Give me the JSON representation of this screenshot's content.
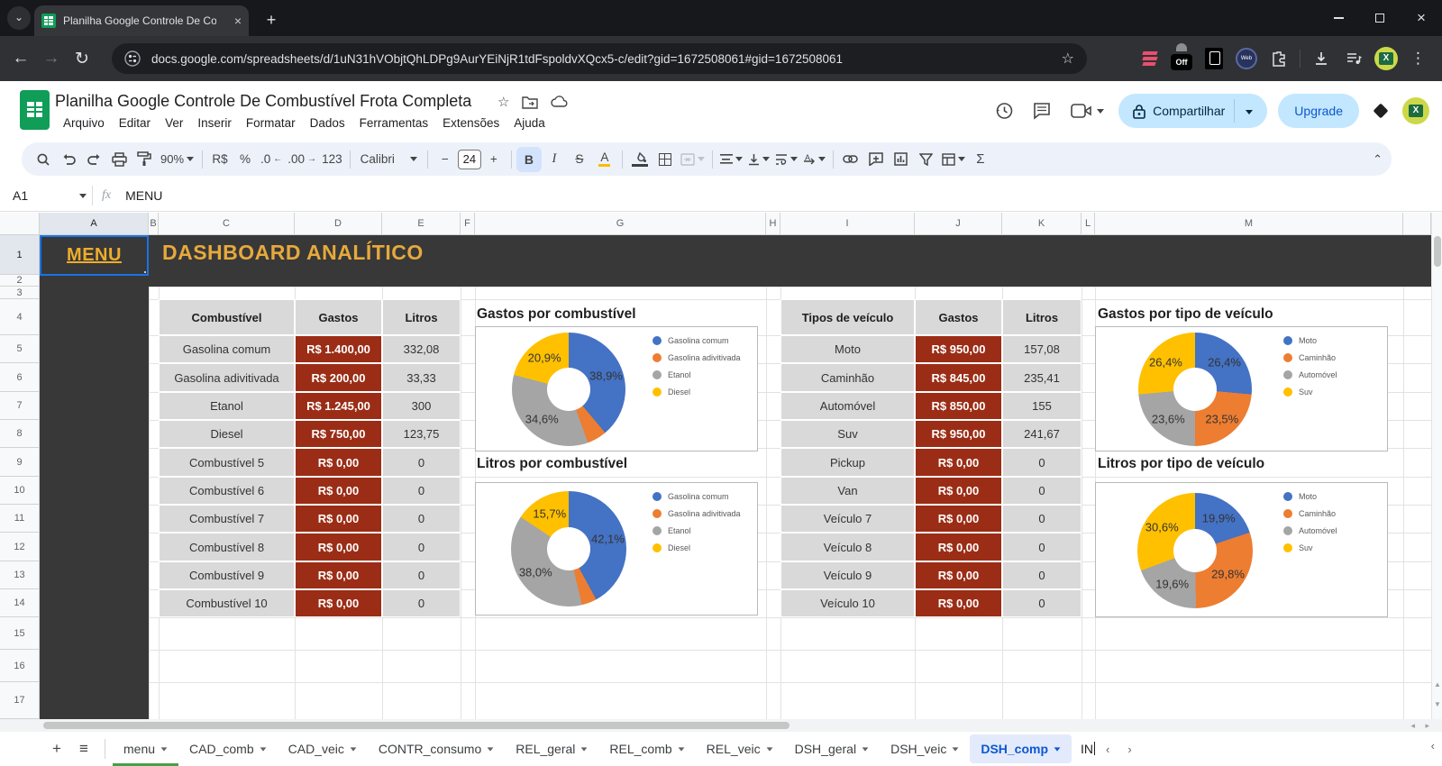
{
  "browser": {
    "tab_title": "Planilha Google Controle De Co",
    "url": "docs.google.com/spreadsheets/d/1uN31hVObjtQhLDPg9AurYEiNjR1tdFspoldvXQcx5-c/edit?gid=1672508061#gid=1672508061",
    "web_badge": "Web",
    "off_badge": "Off"
  },
  "header": {
    "title": "Planilha Google Controle De Combustível Frota Completa",
    "menus": [
      "Arquivo",
      "Editar",
      "Ver",
      "Inserir",
      "Formatar",
      "Dados",
      "Ferramentas",
      "Extensões",
      "Ajuda"
    ],
    "share_label": "Compartilhar",
    "upgrade_label": "Upgrade"
  },
  "toolbar": {
    "zoom": "90%",
    "currency": "R$",
    "percent": "%",
    "dec_decimal": ".0",
    "inc_decimal": ".00",
    "format_123": "123",
    "font": "Calibri",
    "font_size": "24",
    "bold": "B",
    "italic": "I",
    "strike": "S",
    "text_color": "A",
    "fill": "A",
    "sum": "Σ"
  },
  "formula_bar": {
    "cell_ref": "A1",
    "fx": "fx",
    "value": "MENU"
  },
  "grid": {
    "col_letters": [
      "A",
      "B",
      "C",
      "D",
      "E",
      "F",
      "G",
      "H",
      "I",
      "J",
      "K",
      "L",
      "M"
    ],
    "row_numbers": [
      "1",
      "2",
      "3",
      "4",
      "5",
      "6",
      "7",
      "8",
      "9",
      "10",
      "11",
      "12",
      "13",
      "14",
      "15",
      "16",
      "17"
    ],
    "a1_value": "MENU",
    "dashboard_title": "DASHBOARD ANALÍTICO"
  },
  "tables": [
    {
      "headers": [
        "Combustível",
        "Gastos",
        "Litros"
      ],
      "rows": [
        [
          "Gasolina comum",
          "R$ 1.400,00",
          "332,08"
        ],
        [
          "Gasolina adivitivada",
          "R$ 200,00",
          "33,33"
        ],
        [
          "Etanol",
          "R$ 1.245,00",
          "300"
        ],
        [
          "Diesel",
          "R$ 750,00",
          "123,75"
        ],
        [
          "Combustível 5",
          "R$ 0,00",
          "0"
        ],
        [
          "Combustível 6",
          "R$ 0,00",
          "0"
        ],
        [
          "Combustível 7",
          "R$ 0,00",
          "0"
        ],
        [
          "Combustível 8",
          "R$ 0,00",
          "0"
        ],
        [
          "Combustível 9",
          "R$ 0,00",
          "0"
        ],
        [
          "Combustível 10",
          "R$ 0,00",
          "0"
        ]
      ]
    },
    {
      "headers": [
        "Tipos de veículo",
        "Gastos",
        "Litros"
      ],
      "rows": [
        [
          "Moto",
          "R$ 950,00",
          "157,08"
        ],
        [
          "Caminhão",
          "R$ 845,00",
          "235,41"
        ],
        [
          "Automóvel",
          "R$ 850,00",
          "155"
        ],
        [
          "Suv",
          "R$ 950,00",
          "241,67"
        ],
        [
          "Pickup",
          "R$ 0,00",
          "0"
        ],
        [
          "Van",
          "R$ 0,00",
          "0"
        ],
        [
          "Veículo 7",
          "R$ 0,00",
          "0"
        ],
        [
          "Veículo 8",
          "R$ 0,00",
          "0"
        ],
        [
          "Veículo 9",
          "R$ 0,00",
          "0"
        ],
        [
          "Veículo 10",
          "R$ 0,00",
          "0"
        ]
      ]
    }
  ],
  "chart_data": [
    {
      "type": "pie",
      "title": "Gastos por combustível",
      "categories": [
        "Gasolina comum",
        "Gasolina adivitivada",
        "Etanol",
        "Diesel"
      ],
      "values": [
        38.9,
        5.6,
        34.6,
        20.9
      ],
      "labels": [
        "38,9%",
        "",
        "34,6%",
        "20,9%"
      ],
      "colors": [
        "#4472C4",
        "#ED7D31",
        "#A5A5A5",
        "#FFC000"
      ],
      "legend_position": "right"
    },
    {
      "type": "pie",
      "title": "Litros por combustível",
      "categories": [
        "Gasolina comum",
        "Gasolina adivitivada",
        "Etanol",
        "Diesel"
      ],
      "values": [
        42.1,
        4.2,
        38.0,
        15.7
      ],
      "labels": [
        "42,1%",
        "",
        "38,0%",
        "15,7%"
      ],
      "colors": [
        "#4472C4",
        "#ED7D31",
        "#A5A5A5",
        "#FFC000"
      ],
      "legend_position": "right"
    },
    {
      "type": "pie",
      "title": "Gastos por tipo de veículo",
      "categories": [
        "Moto",
        "Caminhão",
        "Automóvel",
        "Suv"
      ],
      "values": [
        26.4,
        23.5,
        23.6,
        26.4
      ],
      "labels": [
        "26,4%",
        "23,5%",
        "23,6%",
        "26,4%"
      ],
      "colors": [
        "#4472C4",
        "#ED7D31",
        "#A5A5A5",
        "#FFC000"
      ],
      "legend_position": "right"
    },
    {
      "type": "pie",
      "title": "Litros por tipo de veículo",
      "categories": [
        "Moto",
        "Caminhão",
        "Automóvel",
        "Suv"
      ],
      "values": [
        19.9,
        29.8,
        19.6,
        30.6
      ],
      "labels": [
        "19,9%",
        "29,8%",
        "19,6%",
        "30,6%"
      ],
      "colors": [
        "#4472C4",
        "#ED7D31",
        "#A5A5A5",
        "#FFC000"
      ],
      "legend_position": "right"
    }
  ],
  "sheet_tabs": {
    "items": [
      "menu",
      "CAD_comb",
      "CAD_veic",
      "CONTR_consumo",
      "REL_geral",
      "REL_comb",
      "REL_veic",
      "DSH_geral",
      "DSH_veic",
      "DSH_comp"
    ],
    "active": "DSH_comp",
    "green_tab": "menu",
    "partial": "IN"
  },
  "colors": {
    "selection_blue": "#1a73e8",
    "gold": "#E7A93C",
    "table_red": "#9B2D16",
    "table_gray": "#D9D9D9",
    "dark_header": "#383838",
    "pie_blue": "#4472C4",
    "pie_orange": "#ED7D31",
    "pie_gray": "#A5A5A5",
    "pie_yellow": "#FFC000"
  }
}
